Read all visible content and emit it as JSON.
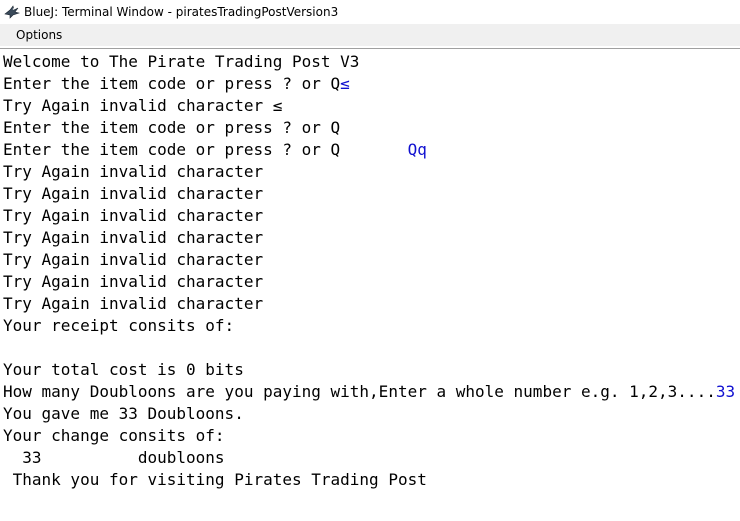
{
  "window": {
    "title": "BlueJ: Terminal Window - piratesTradingPostVersion3",
    "icon": "bluej-bird-icon"
  },
  "menubar": {
    "items": [
      {
        "label": "Options"
      }
    ]
  },
  "colors": {
    "output_text": "#000000",
    "user_input_text": "#1010d0",
    "menubar_bg": "#f0f0f0"
  },
  "terminal": {
    "lines": [
      {
        "text": "Welcome to The Pirate Trading Post V3",
        "input": ""
      },
      {
        "text": "Enter the item code or press ? or Q",
        "input": "≤"
      },
      {
        "text": "Try Again invalid character ≤",
        "input": ""
      },
      {
        "text": "Enter the item code or press ? or Q",
        "input": ""
      },
      {
        "text": "Enter the item code or press ? or Q",
        "input": "       Qq"
      },
      {
        "text": "Try Again invalid character",
        "input": ""
      },
      {
        "text": "Try Again invalid character",
        "input": ""
      },
      {
        "text": "Try Again invalid character",
        "input": ""
      },
      {
        "text": "Try Again invalid character",
        "input": ""
      },
      {
        "text": "Try Again invalid character",
        "input": ""
      },
      {
        "text": "Try Again invalid character",
        "input": ""
      },
      {
        "text": "Try Again invalid character",
        "input": ""
      },
      {
        "text": "Your receipt consits of:",
        "input": ""
      },
      {
        "text": "",
        "input": ""
      },
      {
        "text": "Your total cost is 0 bits",
        "input": ""
      },
      {
        "text": "How many Doubloons are you paying with,Enter a whole number e.g. 1,2,3....",
        "input": "33"
      },
      {
        "text": "You gave me 33 Doubloons.",
        "input": ""
      },
      {
        "text": "Your change consits of:",
        "input": ""
      },
      {
        "text": "  33          doubloons",
        "input": ""
      },
      {
        "text": " Thank you for visiting Pirates Trading Post",
        "input": ""
      }
    ]
  }
}
